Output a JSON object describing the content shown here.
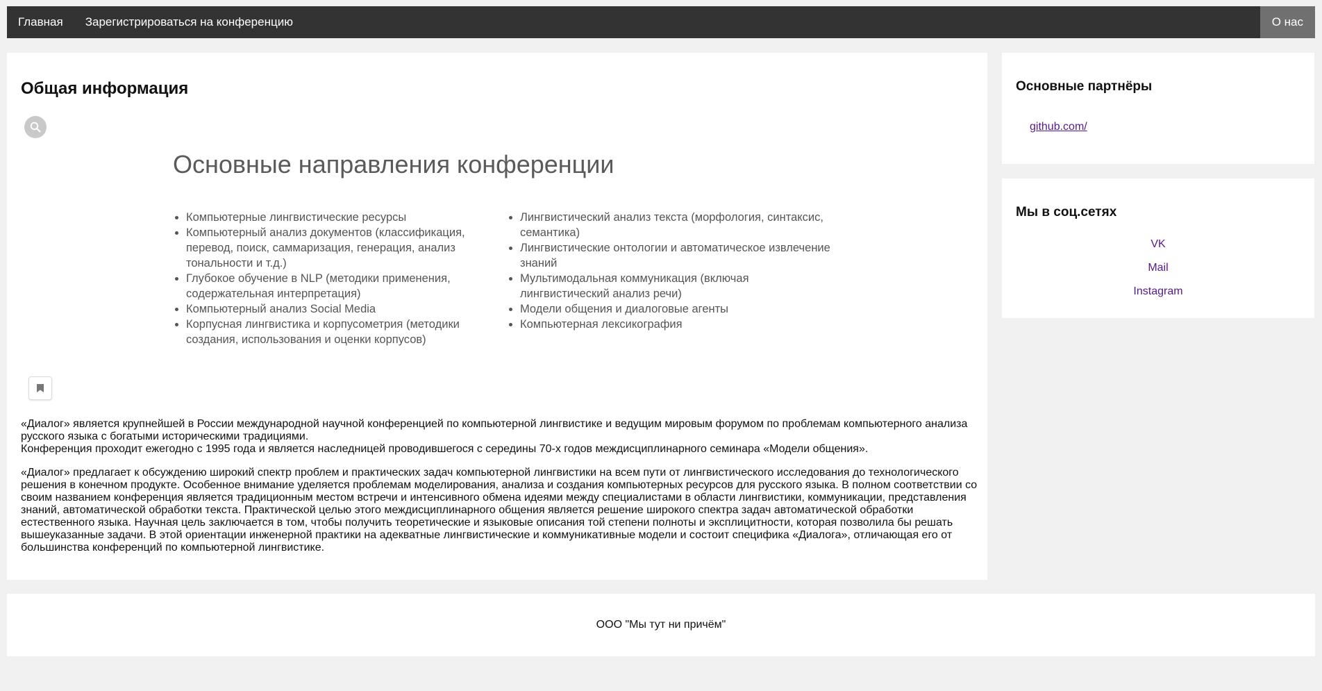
{
  "nav": {
    "home": "Главная",
    "register": "Зарегистрироваться на конференцию",
    "about": "О нас"
  },
  "main": {
    "title": "Общая информация",
    "image": {
      "heading": "Основные направления конференции",
      "left_items": [
        "Компьютерные лингвистические ресурсы",
        "Компьютерный анализ документов (классификация, перевод, поиск, саммаризация, генерация, анализ тональности и т.д.)",
        "Глубокое обучение в NLP (методики применения, содержательная интерпретация)",
        "Компьютерный анализ Social Media",
        "Корпусная лингвистика и корпусометрия (методики создания, использования и оценки корпусов)"
      ],
      "right_items": [
        "Лингвистический анализ текста (морфология, синтаксис, семантика)",
        "Лингвистические онтологии и автоматическое извлечение знаний",
        "Мультимодальная коммуникация (включая лингвистический анализ речи)",
        "Модели общения и диалоговые агенты",
        "Компьютерная лексикография"
      ]
    },
    "paragraph1": {
      "line1": "«Диалог» является крупнейшей в России международной научной конференцией по компьютерной лингвистике и ведущим мировым форумом по проблемам компьютерного анализа русского языка с богатыми историческими традициями.",
      "line2": "Конференция проходит ежегодно с 1995 года и является наследницей проводившегося с середины 70-х годов междисциплинарного семинара «Модели общения»."
    },
    "paragraph2": "«Диалог» предлагает к обсуждению широкий спектр проблем и практических задач компьютерной лингвистики на всем пути от лингвистического исследования до технологического решения в конечном продукте. Особенное внимание уделяется проблемам моделирования, анализа и создания компьютерных ресурсов для русского языка. В полном соответствии со своим названием конференция является традиционным местом встречи и интенсивного обмена идеями между специалистами в области лингвистики, коммуникации, представления знаний, автоматической обработки текста. Практической целью этого междисциплинарного общения является решение широкого спектра задач автоматической обработки естественного языка. Научная цель заключается в том, чтобы получить теоретические и языковые описания той степени полноты и эксплицитности, которая позволила бы решать вышеуказанные задачи. В этой ориентации инженерной практики на адекватные лингвистические и коммуникативные модели и состоит специфика «Диалога», отличающая его от большинства конференций по компьютерной лингвистике."
  },
  "sidebar": {
    "partners_title": "Основные партнёры",
    "partner_link": "github.com/",
    "social_title": "Мы в соц.сетях",
    "social_links": [
      "VK",
      "Mail",
      "Instagram"
    ]
  },
  "footer": {
    "text": "ООО \"Мы тут ни причём\""
  },
  "colors": {
    "nav_bg": "#333333",
    "nav_active_bg": "#707070",
    "page_bg": "#f1f1f1",
    "link": "#551a8b"
  },
  "icons": [
    "search-icon",
    "bookmark-icon"
  ]
}
